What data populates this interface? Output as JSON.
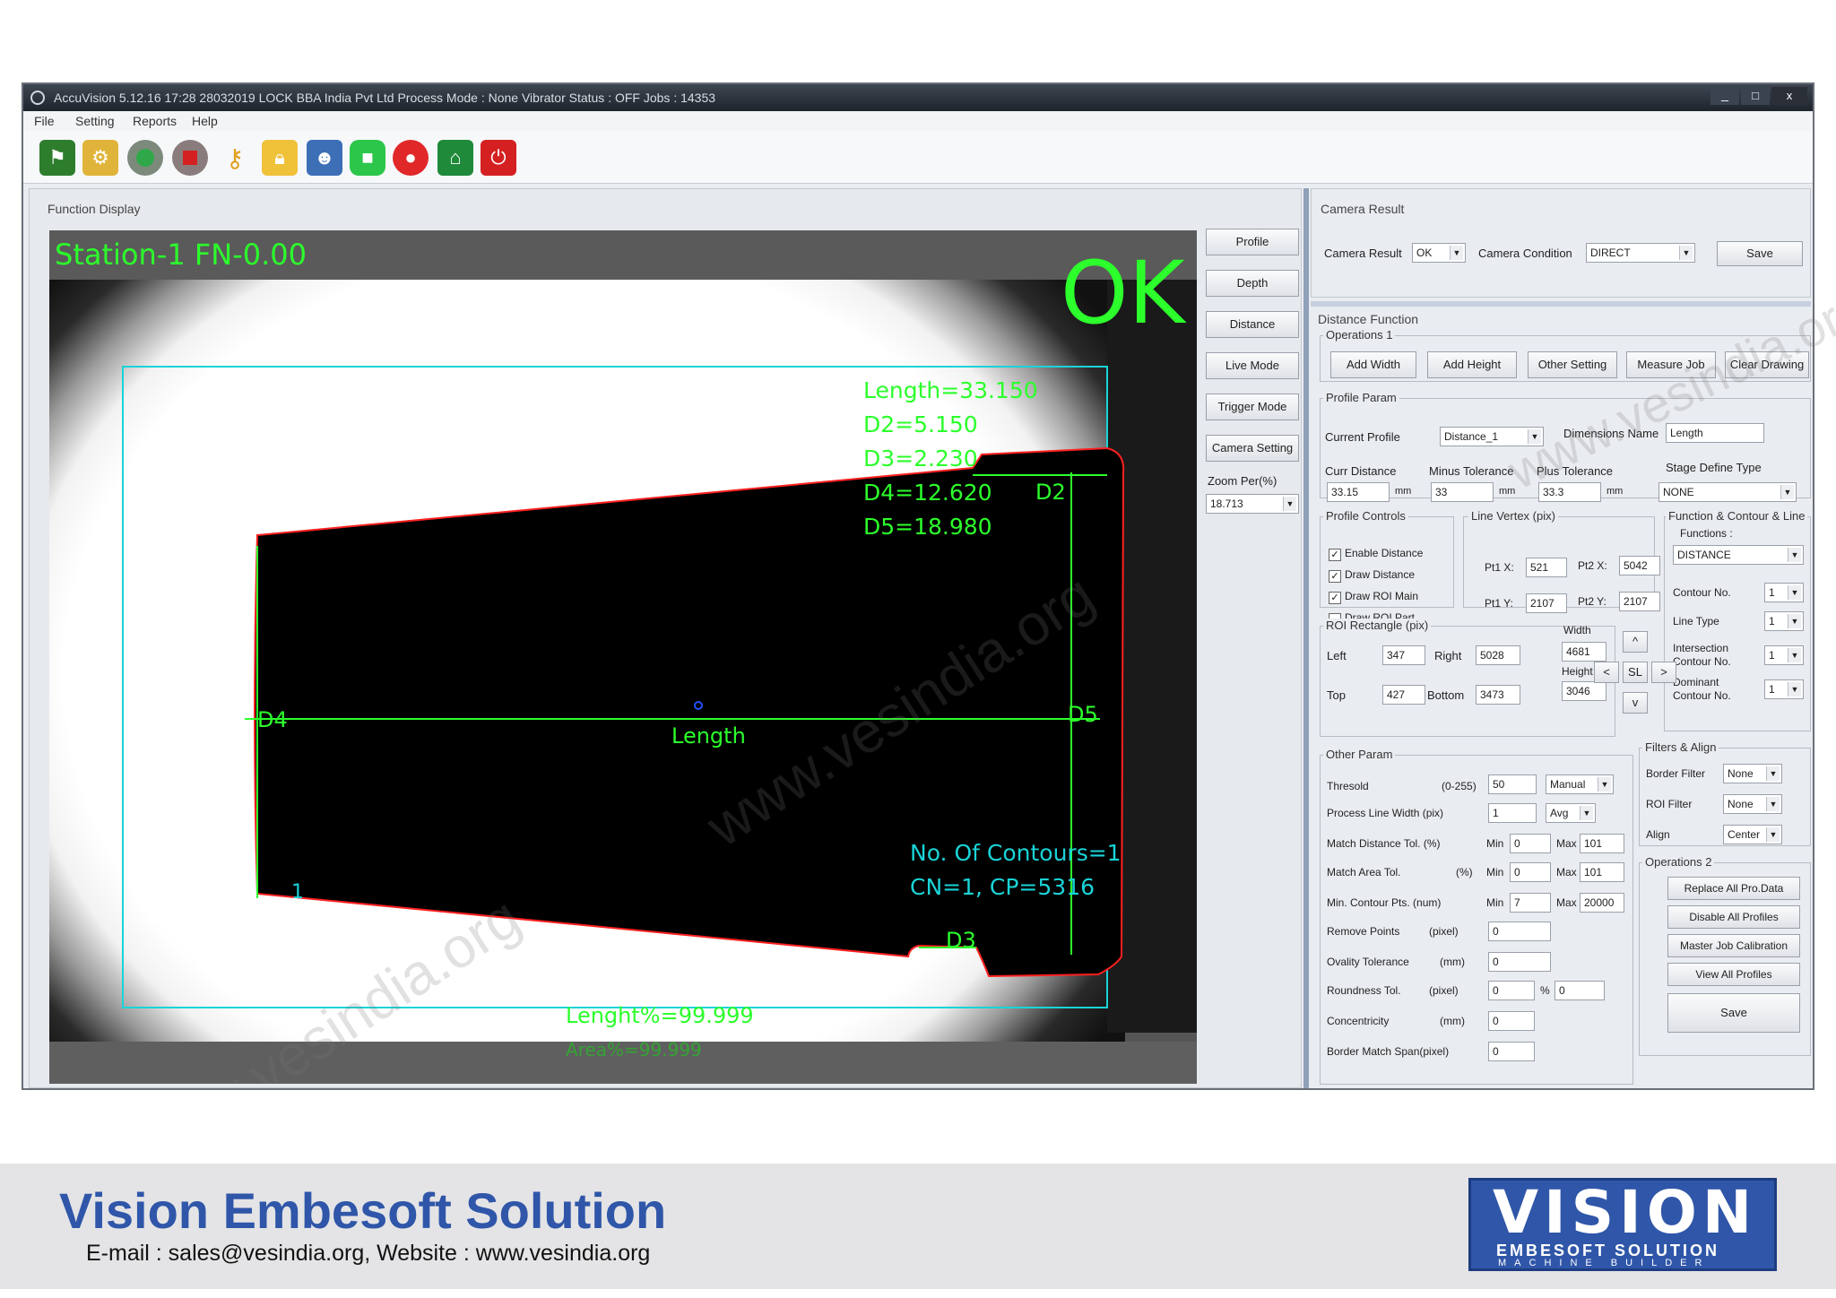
{
  "window": {
    "title_bar": "AccuVision 5.12.16   17:28   28032019 LOCK   BBA India Pvt Ltd   Process Mode : None   Vibrator Status : OFF   Jobs : 14353",
    "controls": [
      "_",
      "□",
      "x"
    ]
  },
  "menu": [
    "File",
    "Setting",
    "Reports",
    "Help"
  ],
  "toolbar_icons": [
    "flag-icon",
    "gear-icon",
    "play-icon",
    "stop-icon",
    "key-icon",
    "lock-icon",
    "user-icon",
    "video-icon",
    "record-icon",
    "home-icon",
    "power-icon"
  ],
  "function_display": {
    "title": "Function Display",
    "station": "Station-1  FN-0.00",
    "result": "OK",
    "measurements": [
      "Length=33.150",
      "D2=5.150",
      "D3=2.230",
      "D4=12.620",
      "D5=18.980"
    ],
    "labels": {
      "d2": "D2",
      "d3": "D3",
      "d4": "D4",
      "d5": "D5",
      "length": "Length",
      "one": "1"
    },
    "contours": [
      "No. Of Contours=1",
      "CN=1, CP=5316"
    ],
    "length_pct": "Lenght%=99.999",
    "area_pct": "Area%=99.999",
    "watermarks": [
      "www.vesindia.org",
      "www.vesindia.org",
      "www.vesindia.org"
    ]
  },
  "side_buttons": [
    "Profile",
    "Depth",
    "Distance",
    "Live Mode",
    "Trigger Mode",
    "Camera Setting"
  ],
  "zoom": {
    "label": "Zoom Per(%)",
    "value": "18.713"
  },
  "camera_result": {
    "title": "Camera Result",
    "result_label": "Camera Result",
    "result_value": "OK",
    "condition_label": "Camera Condition",
    "condition_value": "DIRECT",
    "save": "Save"
  },
  "distance_function": {
    "title": "Distance Function",
    "operations1": {
      "title": "Operations 1",
      "buttons": [
        "Add Width",
        "Add Height",
        "Other Setting",
        "Measure Job",
        "Clear Drawing"
      ]
    },
    "profile_param": {
      "title": "Profile Param",
      "current_profile_label": "Current Profile",
      "current_profile": "Distance_1",
      "dim_name_label": "Dimensions Name",
      "dim_name": "Length",
      "curr_distance_label": "Curr Distance",
      "curr_distance": "33.15",
      "minus_tol_label": "Minus Tolerance",
      "minus_tol": "33",
      "plus_tol_label": "Plus Tolerance",
      "plus_tol": "33.3",
      "mm": "mm",
      "stage_label": "Stage Define Type",
      "stage": "NONE"
    },
    "profile_controls": {
      "title": "Profile Controls",
      "items": [
        {
          "label": "Enable Distance",
          "checked": "✓"
        },
        {
          "label": "Draw Distance",
          "checked": "✓"
        },
        {
          "label": "Draw ROI Main",
          "checked": "✓"
        },
        {
          "label": "Draw ROI Part",
          "checked": ""
        }
      ]
    },
    "line_vertex": {
      "title": "Line Vertex (pix)",
      "pt1x_label": "Pt1 X:",
      "pt1x": "521",
      "pt2x_label": "Pt2 X:",
      "pt2x": "5042",
      "pt1y_label": "Pt1 Y:",
      "pt1y": "2107",
      "pt2y_label": "Pt2 Y:",
      "pt2y": "2107"
    },
    "fcl": {
      "title": "Function & Contour & Line",
      "functions_label": "Functions :",
      "functions": "DISTANCE",
      "contour_no_label": "Contour No.",
      "contour_no": "1",
      "line_type_label": "Line Type",
      "line_type": "1",
      "intersection_label": "Intersection Contour No.",
      "intersection": "1",
      "dominant_label": "Dominant Contour No.",
      "dominant": "1"
    },
    "roi": {
      "title": "ROI Rectangle (pix)",
      "left_label": "Left",
      "left": "347",
      "right_label": "Right",
      "right": "5028",
      "width_label": "Width",
      "width": "4681",
      "top_label": "Top",
      "top": "427",
      "bottom_label": "Bottom",
      "bottom": "3473",
      "height_label": "Height",
      "height": "3046"
    },
    "nav": {
      "up": "^",
      "left": "<",
      "sl": "SL",
      "right": ">",
      "down": "v"
    },
    "other_param": {
      "title": "Other Param",
      "rows": [
        {
          "label": "Thresold",
          "unit": "(0-255)",
          "v1": "50",
          "sel": "Manual"
        },
        {
          "label": "Process Line Width (pix)",
          "unit": "",
          "v1": "1",
          "sel": "Avg"
        },
        {
          "label": "Match Distance Tol. (%)",
          "unit": "",
          "min": "0",
          "max": "101"
        },
        {
          "label": "Match Area Tol.",
          "unit": "(%)",
          "min": "0",
          "max": "101"
        },
        {
          "label": "Min. Contour Pts. (num)",
          "unit": "",
          "min": "7",
          "max": "20000"
        },
        {
          "label": "Remove Points",
          "unit": "(pixel)",
          "v1": "0"
        },
        {
          "label": "Ovality Tolerance",
          "unit": "(mm)",
          "v1": "0"
        },
        {
          "label": "Roundness Tol.",
          "unit": "(pixel)",
          "v1": "0",
          "pct": "%",
          "v2": "0"
        },
        {
          "label": "Concentricity",
          "unit": "(mm)",
          "v1": "0"
        },
        {
          "label": "Border Match Span(pixel)",
          "unit": "",
          "v1": "0"
        }
      ],
      "min_label": "Min",
      "max_label": "Max"
    },
    "filters": {
      "title": "Filters & Align",
      "border_label": "Border Filter",
      "border": "None",
      "roi_label": "ROI Filter",
      "roi": "None",
      "align_label": "Align",
      "align": "Center"
    },
    "operations2": {
      "title": "Operations 2",
      "buttons": [
        "Replace All Pro.Data",
        "Disable All Profiles",
        "Master Job Calibration",
        "View All Profiles",
        "Save"
      ]
    }
  },
  "footer": {
    "company": "Vision Embesoft Solution",
    "contact": "E-mail : sales@vesindia.org, Website : www.vesindia.org",
    "logo_text": "VISION",
    "logo_sub1": "EMBESOFT SOLUTION",
    "logo_sub2": "MACHINE  BUILDER"
  },
  "colors": {
    "accent": "#2f56a8",
    "overlay_green": "#2cff2c",
    "roi_cyan": "#19d4d8",
    "contour_red": "#ff2020"
  }
}
